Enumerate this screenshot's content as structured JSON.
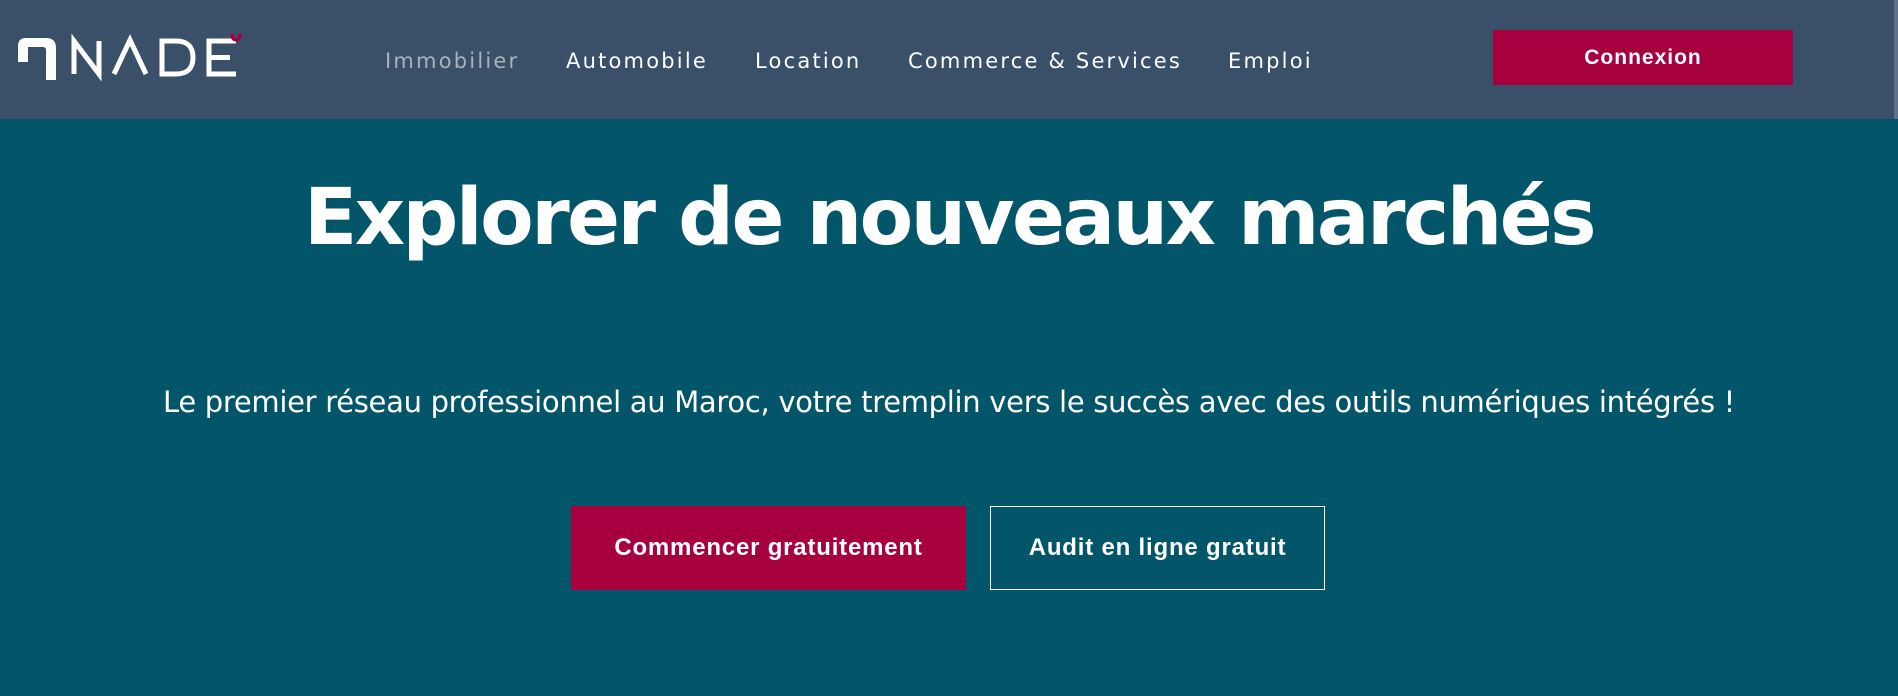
{
  "brand": {
    "name": "NADE",
    "accent_color": "#a6003f",
    "header_color": "#3a5068",
    "hero_color": "#03556a"
  },
  "nav": {
    "items": [
      {
        "label": "Immobilier",
        "active": true
      },
      {
        "label": "Automobile",
        "active": false
      },
      {
        "label": "Location",
        "active": false
      },
      {
        "label": "Commerce & Services",
        "active": false
      },
      {
        "label": "Emploi",
        "active": false
      }
    ],
    "login_label": "Connexion"
  },
  "hero": {
    "title": "Explorer de nouveaux marchés",
    "subtitle": "Le premier réseau professionnel au Maroc, votre tremplin vers le succès avec des outils numériques intégrés !",
    "primary_cta": "Commencer gratuitement",
    "secondary_cta": "Audit en ligne gratuit"
  }
}
